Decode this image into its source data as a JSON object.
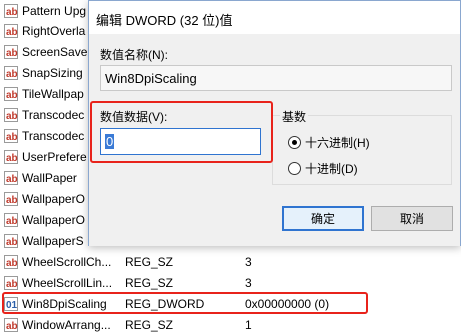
{
  "registry": {
    "rows": [
      {
        "name": "Pattern Upgrade",
        "type": "",
        "data": ""
      },
      {
        "name": "RightOverlapChars",
        "type": "",
        "data": ""
      },
      {
        "name": "ScreenSaveActive",
        "type": "",
        "data": ""
      },
      {
        "name": "SnapSizing",
        "type": "",
        "data": ""
      },
      {
        "name": "TileWallpaper",
        "type": "",
        "data": ""
      },
      {
        "name": "TranscodedImageCache",
        "type": "",
        "data": ""
      },
      {
        "name": "TranscodedImageCount",
        "type": "",
        "data": ""
      },
      {
        "name": "UserPreferencesMask",
        "type": "",
        "data": ""
      },
      {
        "name": "WallPaper",
        "type": "",
        "data": ""
      },
      {
        "name": "WallpaperOriginX",
        "type": "",
        "data": ""
      },
      {
        "name": "WallpaperOriginY",
        "type": "",
        "data": ""
      },
      {
        "name": "WallpaperStyle",
        "type": "",
        "data": ""
      },
      {
        "name": "WheelScrollChars",
        "type": "REG_SZ",
        "data": "3"
      },
      {
        "name": "WheelScrollLines",
        "type": "REG_SZ",
        "data": "3"
      },
      {
        "name": "Win8DpiScaling",
        "type": "REG_DWORD",
        "data": "0x00000000 (0)"
      },
      {
        "name": "WindowArrangementActive",
        "type": "REG_SZ",
        "data": "1"
      }
    ],
    "truncated_names": [
      "Pattern Upg",
      "RightOverla",
      "ScreenSave",
      "SnapSizing",
      "TileWallpap",
      "Transcodec",
      "Transcodec",
      "UserPrefere",
      "WallPaper",
      "WallpaperO",
      "WallpaperO",
      "WallpaperS",
      "WheelScrollCh...",
      "WheelScrollLin...",
      "Win8DpiScaling",
      "WindowArrang..."
    ]
  },
  "dialog": {
    "title": "编辑 DWORD (32 位)值",
    "name_label": "数值名称(N):",
    "name_value": "Win8DpiScaling",
    "data_label": "数值数据(V):",
    "data_value": "0",
    "base_label": "基数",
    "hex_label": "十六进制(H)",
    "dec_label": "十进制(D)",
    "selected_base": "hex",
    "ok_label": "确定",
    "cancel_label": "取消"
  },
  "colors": {
    "highlight": "#e8231b",
    "accent": "#2f74d0"
  },
  "icons": {
    "value_icon": "reg-binary-value-icon"
  }
}
